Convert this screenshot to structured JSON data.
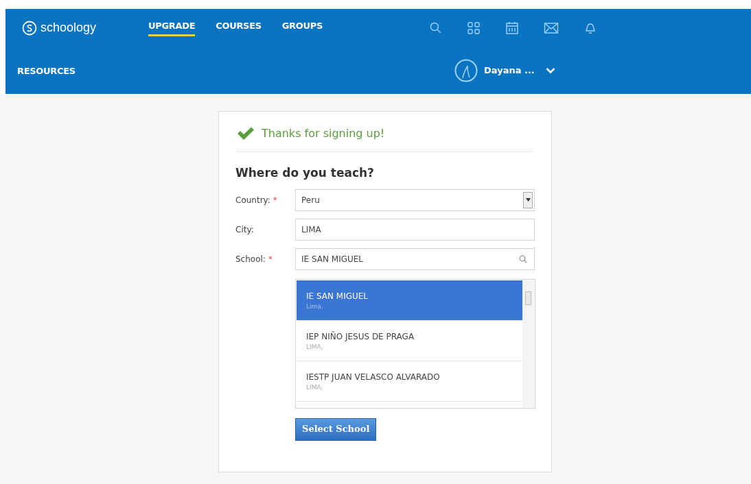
{
  "header": {
    "logo": "schoology",
    "nav": [
      {
        "label": "UPGRADE",
        "selected": true
      },
      {
        "label": "COURSES",
        "selected": false
      },
      {
        "label": "GROUPS",
        "selected": false
      }
    ],
    "nav_row2": [
      {
        "label": "RESOURCES",
        "selected": false
      }
    ],
    "user": {
      "name": "Dayana ..."
    }
  },
  "card": {
    "success": "Thanks for signing up!",
    "heading": "Where do you teach?",
    "fields": [
      {
        "kind": "select",
        "label": "Country:",
        "mark": "*",
        "value": "Peru"
      },
      {
        "kind": "text",
        "label": "City:",
        "value": "LIMA"
      },
      {
        "kind": "search",
        "label": "School:",
        "mark": "*",
        "value": "IE SAN MIGUEL"
      }
    ],
    "results": [
      {
        "name": "IE SAN MIGUEL",
        "city": "Lima,",
        "selected": true
      },
      {
        "name": "IEP NIÑO JESUS DE PRAGA",
        "city": "LIMA,",
        "selected": false
      },
      {
        "name": "IESTP JUAN VELASCO ALVARADO",
        "city": "LIMA,",
        "selected": false
      }
    ],
    "button": "Select School"
  }
}
